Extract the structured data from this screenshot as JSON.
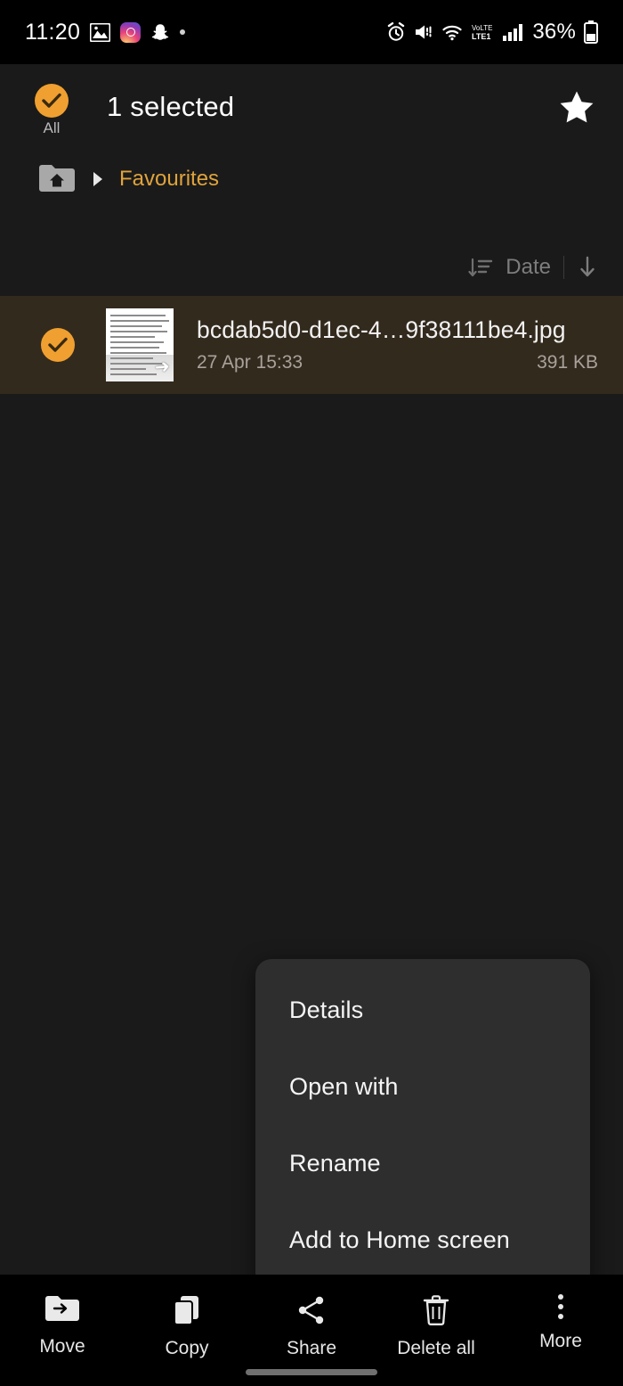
{
  "statusbar": {
    "time": "11:20",
    "left_icons": [
      "photo-icon",
      "instagram-icon",
      "snapchat-icon",
      "dot-icon"
    ],
    "right_icons": [
      "alarm-icon",
      "mute-icon",
      "wifi-icon",
      "volte-icon",
      "signal-icon"
    ],
    "battery_percent": "36%",
    "battery_icon": "battery-icon"
  },
  "header": {
    "select_all_label": "All",
    "title": "1 selected",
    "star_icon": "star-icon",
    "check_icon": "check-icon",
    "accent_color": "#f0a030"
  },
  "breadcrumb": {
    "home_icon": "home-folder-icon",
    "separator_icon": "chevron-right-icon",
    "current": "Favourites",
    "color": "#e0a33c"
  },
  "sortbar": {
    "sort_icon": "sort-icon",
    "label": "Date",
    "direction_icon": "arrow-down-icon"
  },
  "files": [
    {
      "name": "bcdab5d0-d1ec-4…9f38111be4.jpg",
      "date": "27 Apr 15:33",
      "size": "391 KB",
      "selected": true,
      "thumbnail": "document-scan-thumbnail",
      "check_icon": "check-icon"
    }
  ],
  "context_menu": {
    "items": [
      {
        "label": "Details"
      },
      {
        "label": "Open with"
      },
      {
        "label": "Rename"
      },
      {
        "label": "Add to Home screen"
      }
    ],
    "background": "#2e2e2e"
  },
  "bottom_toolbar": {
    "items": [
      {
        "label": "Move",
        "icon": "move-folder-icon"
      },
      {
        "label": "Copy",
        "icon": "copy-icon"
      },
      {
        "label": "Share",
        "icon": "share-icon"
      },
      {
        "label": "Delete all",
        "icon": "trash-icon"
      },
      {
        "label": "More",
        "icon": "more-vertical-icon"
      }
    ]
  }
}
